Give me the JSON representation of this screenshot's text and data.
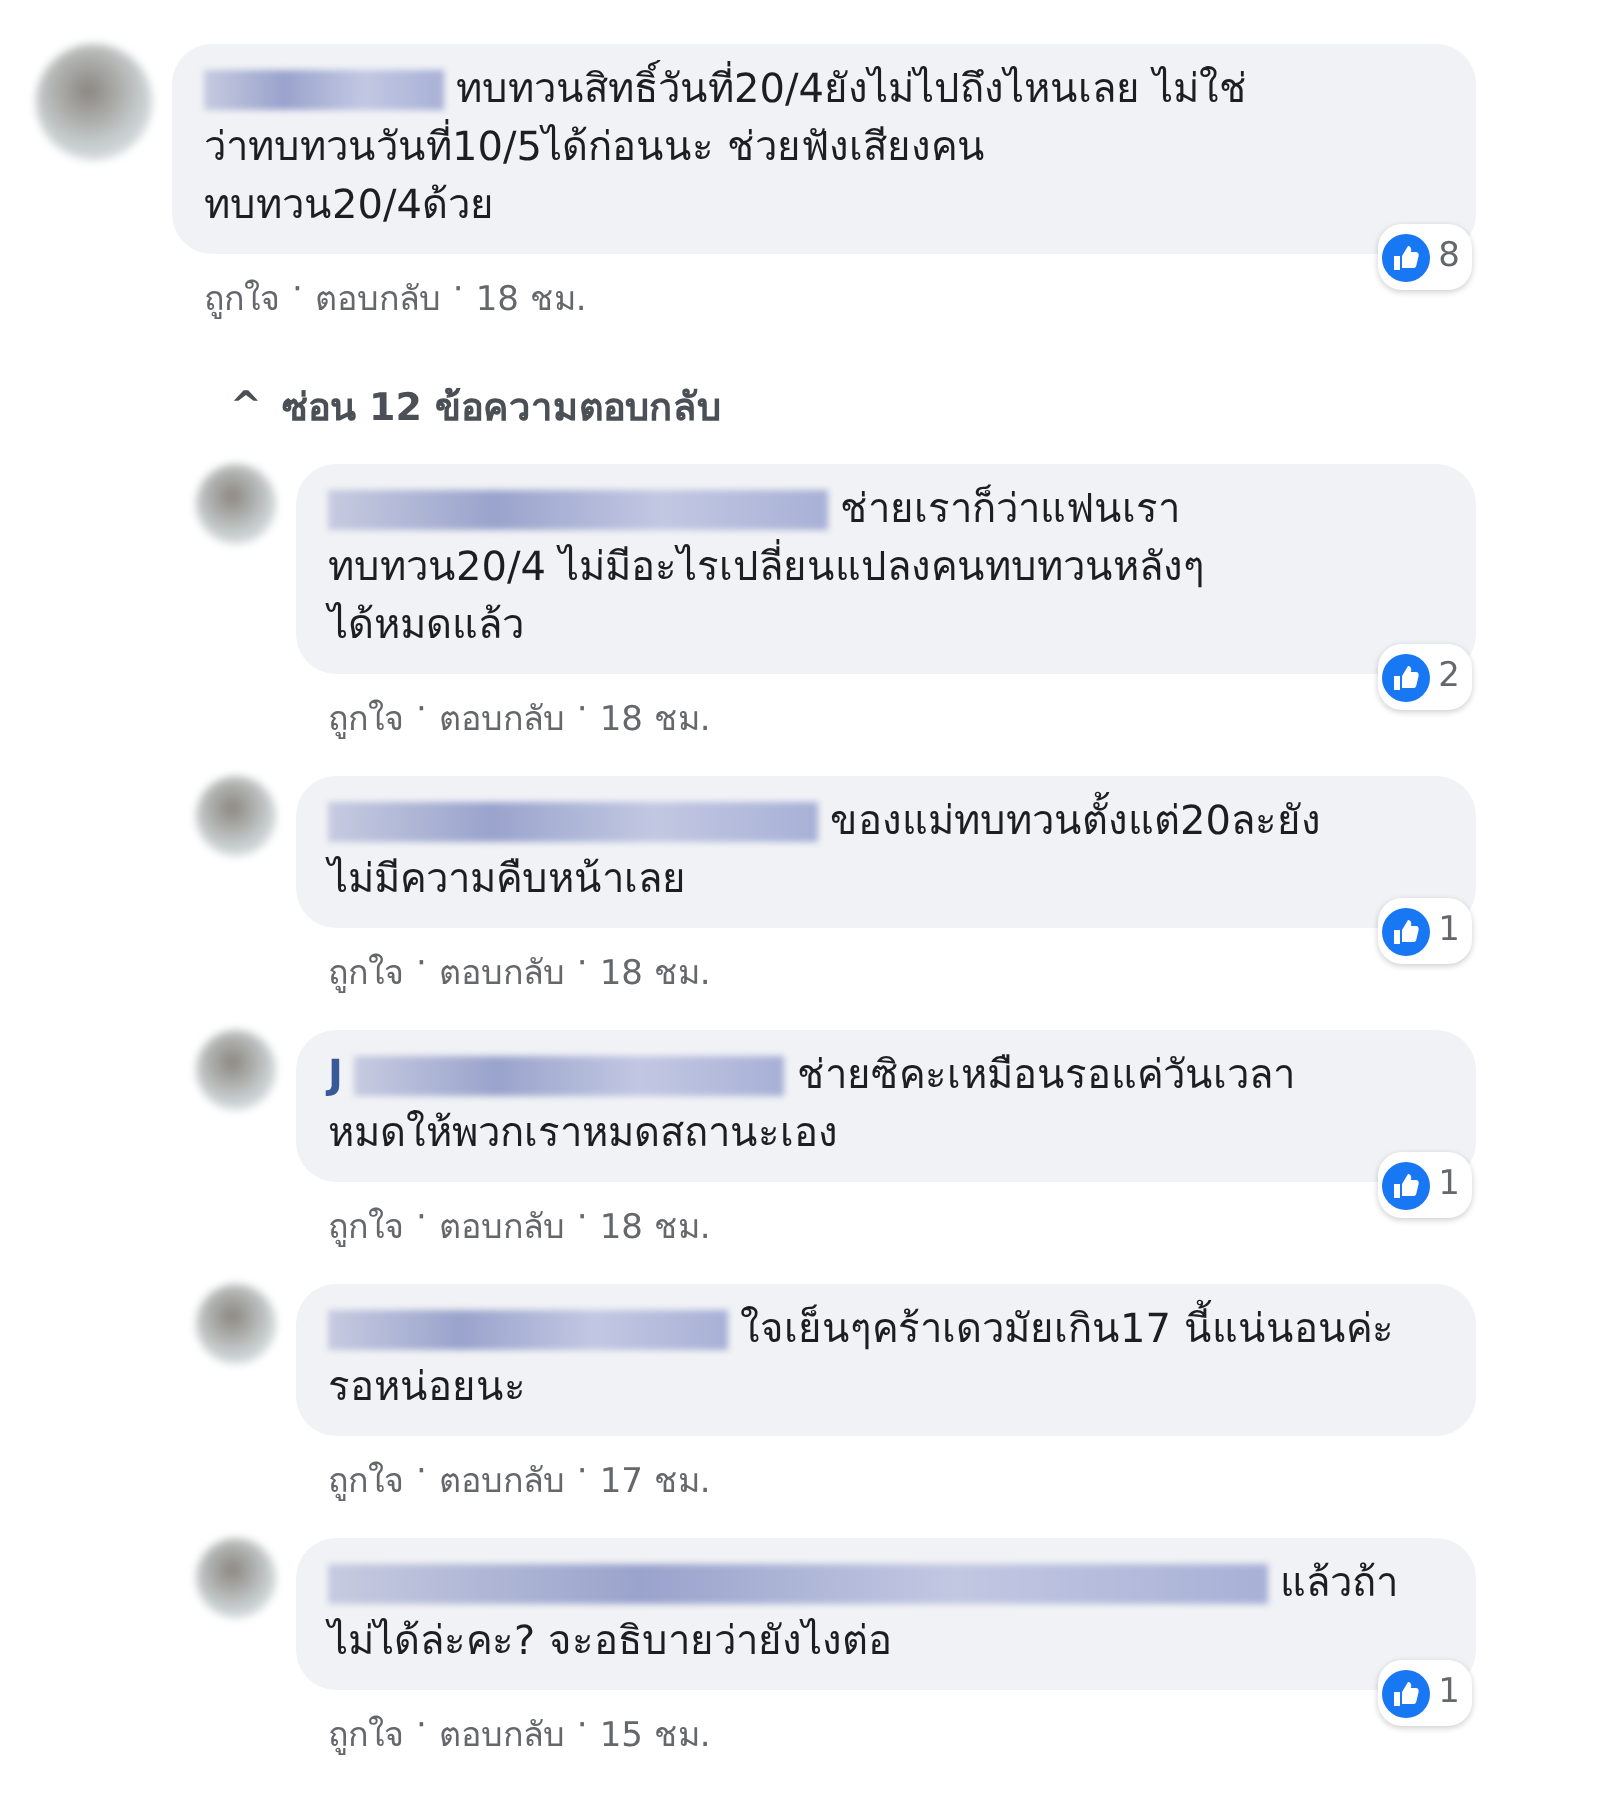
{
  "comment": {
    "lines": [
      "ทบทวนสิทธิ์วันที่20/4ยังไม่ไปถึงไหนเลย ไม่ใช่",
      "ว่าทบทวนวันที่10/5ได้ก่อนนะ ช่วยฟังเสียงคน",
      "ทบทวน20/4ด้วย"
    ],
    "likes": "8",
    "actions": [
      "ถูกใจ",
      "ตอบกลับ"
    ],
    "separator": "·",
    "time": "18 ชม."
  },
  "hide_replies": {
    "arrow": "^",
    "label": "ซ่อน 12 ข้อความตอบกลับ"
  },
  "replies": [
    {
      "lines": [
        "ช่ายเราก็ว่าแฟนเรา",
        "ทบทวน20/4 ไม่มีอะไรเปลี่ยนแปลงคนทบทวนหลังๆ",
        "ได้หมดแล้ว"
      ],
      "likes": "2",
      "actions": [
        "ถูกใจ",
        "ตอบกลับ"
      ],
      "separator": "·",
      "time": "18 ชม."
    },
    {
      "lines": [
        "ของแม่ทบทวนตั้งแต่20ละยัง",
        "ไม่มีความคืบหน้าเลย"
      ],
      "likes": "1",
      "actions": [
        "ถูกใจ",
        "ตอบกลับ"
      ],
      "separator": "·",
      "time": "18 ชม."
    },
    {
      "name_prefix": "J",
      "lines": [
        "ช่ายซิคะเหมือนรอแค่วันเวลา",
        "หมดให้พวกเราหมดสถานะเอง"
      ],
      "likes": "1",
      "actions": [
        "ถูกใจ",
        "ตอบกลับ"
      ],
      "separator": "·",
      "time": "18 ชม."
    },
    {
      "lines": [
        "ใจเย็นๆคร้าเดวมัยเกิน17 นี้แน่นอนค่ะ",
        "รอหน่อยนะ"
      ],
      "actions": [
        "ถูกใจ",
        "ตอบกลับ"
      ],
      "separator": "·",
      "time": "17 ชม."
    },
    {
      "lines": [
        "แล้วถ้า",
        "ไม่ได้ล่ะคะ? จะอธิบายว่ายังไงต่อ"
      ],
      "likes": "1",
      "actions": [
        "ถูกใจ",
        "ตอบกลับ"
      ],
      "separator": "·",
      "time": "15 ชม."
    }
  ]
}
